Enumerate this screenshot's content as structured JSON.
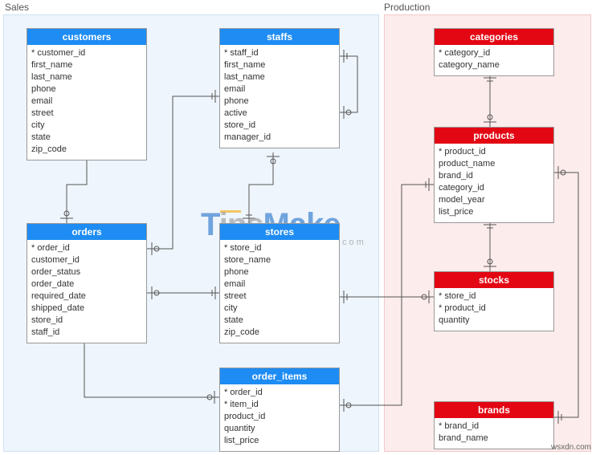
{
  "regions": {
    "sales": {
      "label": "Sales"
    },
    "production": {
      "label": "Production"
    }
  },
  "tables": {
    "customers": {
      "title": "customers",
      "cols": [
        "* customer_id",
        "  first_name",
        "  last_name",
        "  phone",
        "  email",
        "  street",
        "  city",
        "  state",
        "  zip_code"
      ]
    },
    "staffs": {
      "title": "staffs",
      "cols": [
        "* staff_id",
        "  first_name",
        "  last_name",
        "  email",
        "  phone",
        "  active",
        "  store_id",
        "  manager_id"
      ]
    },
    "orders": {
      "title": "orders",
      "cols": [
        "* order_id",
        "  customer_id",
        "  order_status",
        "  order_date",
        "  required_date",
        "  shipped_date",
        "  store_id",
        "  staff_id"
      ]
    },
    "stores": {
      "title": "stores",
      "cols": [
        "* store_id",
        "  store_name",
        "  phone",
        "  email",
        "  street",
        "  city",
        "  state",
        "  zip_code"
      ]
    },
    "order_items": {
      "title": "order_items",
      "cols": [
        "* order_id",
        "* item_id",
        "  product_id",
        "  quantity",
        "  list_price"
      ]
    },
    "categories": {
      "title": "categories",
      "cols": [
        "* category_id",
        "  category_name"
      ]
    },
    "products": {
      "title": "products",
      "cols": [
        "* product_id",
        "  product_name",
        "  brand_id",
        "  category_id",
        "  model_year",
        "  list_price"
      ]
    },
    "stocks": {
      "title": "stocks",
      "cols": [
        "* store_id",
        "* product_id",
        "  quantity"
      ]
    },
    "brands": {
      "title": "brands",
      "cols": [
        "* brand_id",
        "  brand_name"
      ]
    }
  },
  "watermark": {
    "part1": "T",
    "part2": "ips",
    "part3": "Make",
    "com": ".com"
  },
  "credit": "wsxdn.com",
  "chart_data": {
    "type": "erd",
    "schemas": [
      {
        "name": "Sales",
        "tables": [
          {
            "name": "customers",
            "columns": [
              "customer_id",
              "first_name",
              "last_name",
              "phone",
              "email",
              "street",
              "city",
              "state",
              "zip_code"
            ],
            "pk": [
              "customer_id"
            ]
          },
          {
            "name": "staffs",
            "columns": [
              "staff_id",
              "first_name",
              "last_name",
              "email",
              "phone",
              "active",
              "store_id",
              "manager_id"
            ],
            "pk": [
              "staff_id"
            ]
          },
          {
            "name": "orders",
            "columns": [
              "order_id",
              "customer_id",
              "order_status",
              "order_date",
              "required_date",
              "shipped_date",
              "store_id",
              "staff_id"
            ],
            "pk": [
              "order_id"
            ]
          },
          {
            "name": "stores",
            "columns": [
              "store_id",
              "store_name",
              "phone",
              "email",
              "street",
              "city",
              "state",
              "zip_code"
            ],
            "pk": [
              "store_id"
            ]
          },
          {
            "name": "order_items",
            "columns": [
              "order_id",
              "item_id",
              "product_id",
              "quantity",
              "list_price"
            ],
            "pk": [
              "order_id",
              "item_id"
            ]
          }
        ]
      },
      {
        "name": "Production",
        "tables": [
          {
            "name": "categories",
            "columns": [
              "category_id",
              "category_name"
            ],
            "pk": [
              "category_id"
            ]
          },
          {
            "name": "products",
            "columns": [
              "product_id",
              "product_name",
              "brand_id",
              "category_id",
              "model_year",
              "list_price"
            ],
            "pk": [
              "product_id"
            ]
          },
          {
            "name": "stocks",
            "columns": [
              "store_id",
              "product_id",
              "quantity"
            ],
            "pk": [
              "store_id",
              "product_id"
            ]
          },
          {
            "name": "brands",
            "columns": [
              "brand_id",
              "brand_name"
            ],
            "pk": [
              "brand_id"
            ]
          }
        ]
      }
    ],
    "relationships": [
      {
        "from": "orders.customer_id",
        "to": "customers.customer_id"
      },
      {
        "from": "orders.staff_id",
        "to": "staffs.staff_id"
      },
      {
        "from": "orders.store_id",
        "to": "stores.store_id"
      },
      {
        "from": "staffs.store_id",
        "to": "stores.store_id"
      },
      {
        "from": "staffs.manager_id",
        "to": "staffs.staff_id"
      },
      {
        "from": "order_items.order_id",
        "to": "orders.order_id"
      },
      {
        "from": "order_items.product_id",
        "to": "products.product_id"
      },
      {
        "from": "products.category_id",
        "to": "categories.category_id"
      },
      {
        "from": "products.brand_id",
        "to": "brands.brand_id"
      },
      {
        "from": "stocks.product_id",
        "to": "products.product_id"
      },
      {
        "from": "stocks.store_id",
        "to": "stores.store_id"
      }
    ]
  }
}
